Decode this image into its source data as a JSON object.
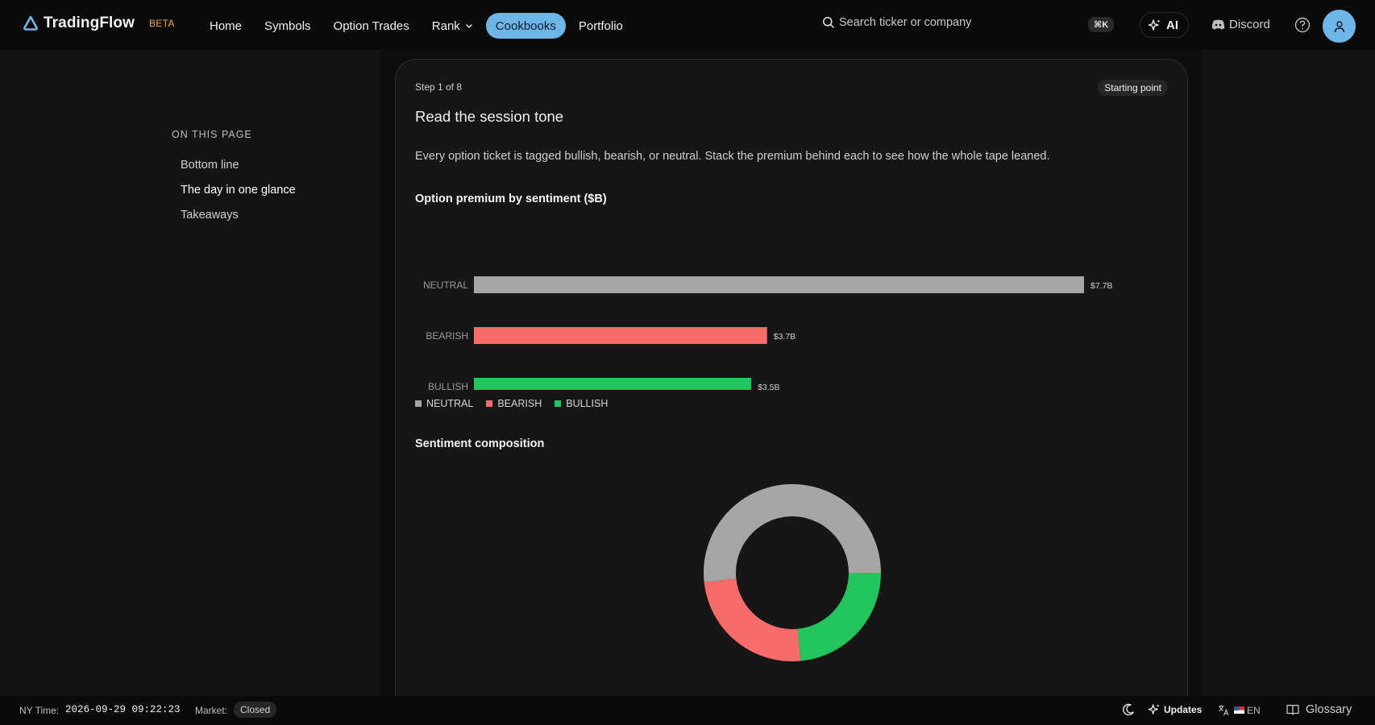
{
  "brand": {
    "name": "TradingFlow",
    "tag": "BETA"
  },
  "nav": {
    "home": "Home",
    "symbols": "Symbols",
    "option_trades": "Option Trades",
    "rank": "Rank",
    "cookbooks": "Cookbooks",
    "portfolio": "Portfolio",
    "active": "Cookbooks"
  },
  "search": {
    "placeholder": "Search ticker or company",
    "shortcut": "⌘K"
  },
  "header_actions": {
    "ai": "AI",
    "discord": "Discord"
  },
  "toc": {
    "heading": "ON THIS PAGE",
    "items": [
      "Bottom line",
      "The day in one glance",
      "Takeaways"
    ],
    "active": "The day in one glance"
  },
  "card": {
    "step": "Step 1 of 8",
    "badge": "Starting point",
    "title": "Read the session tone",
    "description": "Every option ticket is tagged bullish, bearish, or neutral. Stack the premium behind each to see how the whole tape leaned.",
    "bar_section_title": "Option premium by sentiment ($B)",
    "donut_section_title": "Sentiment composition"
  },
  "colors": {
    "neutral": "#a6a6a6",
    "bearish": "#f76b6b",
    "bullish": "#22c55e",
    "accent": "#6cb6e8"
  },
  "chart_data": [
    {
      "type": "bar",
      "orientation": "horizontal",
      "title": "Option premium by sentiment ($B)",
      "categories": [
        "NEUTRAL",
        "BEARISH",
        "BULLISH"
      ],
      "values": [
        7.7,
        3.7,
        3.5
      ],
      "value_labels": [
        "$7.7B",
        "$3.7B",
        "$3.5B"
      ],
      "legend": [
        "NEUTRAL",
        "BEARISH",
        "BULLISH"
      ],
      "legend_position": "bottom-left",
      "grid": false
    },
    {
      "type": "pie",
      "style": "donut",
      "title": "Sentiment composition",
      "categories": [
        "NEUTRAL",
        "BEARISH",
        "BULLISH"
      ],
      "values": [
        7.7,
        3.7,
        3.5
      ]
    }
  ],
  "footer": {
    "ny_time_label": "NY Time:",
    "ny_time": "2026-09-29 09:22:23",
    "market_label": "Market:",
    "market_status": "Closed",
    "updates": "Updates",
    "language": "EN",
    "glossary": "Glossary"
  }
}
